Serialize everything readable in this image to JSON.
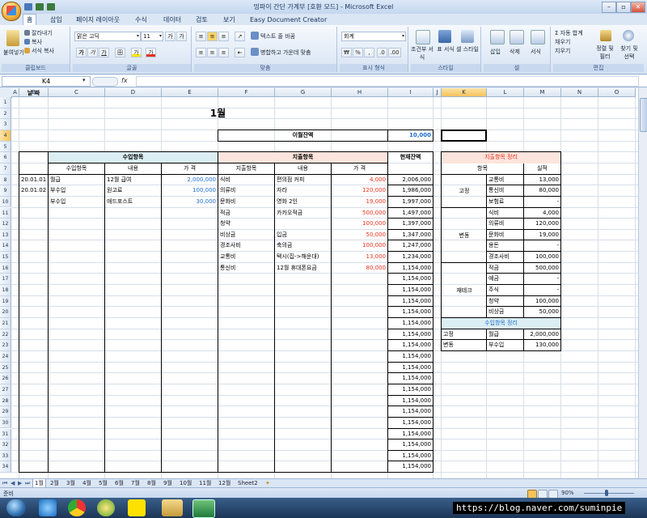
{
  "window": {
    "title": "밍파이 간단 가계부 [호환 모드] - Microsoft Excel",
    "min": "–",
    "max": "▫",
    "close": "✕"
  },
  "tabs": [
    "홈",
    "삽입",
    "페이지 레이아웃",
    "수식",
    "데이터",
    "검토",
    "보기",
    "Easy Document Creator"
  ],
  "ribbon": {
    "clipboard": {
      "paste": "붙여넣기",
      "cut": "잘라내기",
      "copy": "복사",
      "format_painter": "서식 복사",
      "label": "클립보드"
    },
    "font": {
      "name": "맑은 고딕",
      "size": "11",
      "grow": "가",
      "shrink": "가",
      "bold": "가",
      "italic": "가",
      "underline": "가",
      "border": "田",
      "fill": "가",
      "color": "가",
      "label": "글꼴"
    },
    "align": {
      "wrap": "텍스트 줄 바꿈",
      "merge": "병합하고 가운데 맞춤",
      "label": "맞춤"
    },
    "number": {
      "format": "회계",
      "currency": "₩",
      "percent": "%",
      "comma": ",",
      "inc": ".0",
      "dec": ".00",
      "label": "표시 형식"
    },
    "style": {
      "cond": "조건부 서식",
      "table": "표 서식",
      "cell": "셀 스타일",
      "label": "스타일"
    },
    "cells": {
      "insert": "삽입",
      "delete": "삭제",
      "format": "서식",
      "label": "셀"
    },
    "edit": {
      "autosum": "Σ 자동 합계",
      "fill": "채우기",
      "clear": "지우기",
      "sort": "정렬 및 필터",
      "find": "찾기 및 선택",
      "label": "편집"
    }
  },
  "formula_bar": {
    "name_box": "K4",
    "fx": "fx",
    "content": ""
  },
  "columns": [
    "A",
    "B",
    "C",
    "D",
    "E",
    "F",
    "G",
    "H",
    "I",
    "J",
    "K",
    "L",
    "M",
    "N",
    "O"
  ],
  "rows": [
    "1",
    "2",
    "3",
    "4",
    "5",
    "6",
    "7",
    "8",
    "9",
    "10",
    "11",
    "12",
    "13",
    "14",
    "15",
    "16",
    "17",
    "18",
    "19",
    "20",
    "21",
    "22",
    "23",
    "24",
    "25",
    "26",
    "27",
    "28",
    "29",
    "30",
    "31",
    "32",
    "33",
    "34"
  ],
  "sheet": {
    "title": "1월",
    "carry_label": "이월잔액",
    "carry_value": "10,000",
    "date_header": "날 짜",
    "income_header": "수입항목",
    "income_cols": [
      "수입항목",
      "내용",
      "가 격"
    ],
    "expense_header": "지출항목",
    "expense_cols": [
      "지출항목",
      "내용",
      "가 격"
    ],
    "balance_header": "현재잔액",
    "income_rows": [
      {
        "date": "20.01.01",
        "item": "월급",
        "desc": "12월 급여",
        "price": "2,000,000"
      },
      {
        "date": "20.01.02",
        "item": "부수입",
        "desc": "원고료",
        "price": "100,000"
      },
      {
        "date": "",
        "item": "부수입",
        "desc": "애드포스트",
        "price": "30,000"
      }
    ],
    "expense_rows": [
      {
        "item": "식비",
        "desc": "편의점 커피",
        "price": "4,000"
      },
      {
        "item": "의류비",
        "desc": "자라",
        "price": "120,000"
      },
      {
        "item": "문화비",
        "desc": "영화 2인",
        "price": "19,000"
      },
      {
        "item": "적금",
        "desc": "카카오적금",
        "price": "500,000"
      },
      {
        "item": "청약",
        "desc": "",
        "price": "100,000"
      },
      {
        "item": "비상금",
        "desc": "입금",
        "price": "50,000"
      },
      {
        "item": "경조사비",
        "desc": "축의금",
        "price": "100,000"
      },
      {
        "item": "교통비",
        "desc": "택시(집->해운대)",
        "price": "13,000"
      },
      {
        "item": "통신비",
        "desc": "12월 휴대폰요금",
        "price": "80,000"
      }
    ],
    "balances": [
      "2,006,000",
      "1,986,000",
      "1,997,000",
      "1,497,000",
      "1,397,000",
      "1,347,000",
      "1,247,000",
      "1,234,000",
      "1,154,000",
      "1,154,000",
      "1,154,000",
      "1,154,000",
      "1,154,000",
      "1,154,000",
      "1,154,000",
      "1,154,000",
      "1,154,000",
      "1,154,000",
      "1,154,000",
      "1,154,000",
      "1,154,000",
      "1,154,000",
      "1,154,000",
      "1,154,000",
      "1,154,000",
      "1,154,000",
      "1,154,000"
    ],
    "summary_title": "지출항목 정리",
    "summary_cols": [
      "항목",
      "실적"
    ],
    "summary_groups": [
      {
        "group": "고정",
        "rows": [
          {
            "name": "교통비",
            "value": "13,000"
          },
          {
            "name": "통신비",
            "value": "80,000"
          },
          {
            "name": "보험료",
            "value": "-"
          }
        ]
      },
      {
        "group": "변동",
        "rows": [
          {
            "name": "식비",
            "value": "4,000"
          },
          {
            "name": "의류비",
            "value": "120,000"
          },
          {
            "name": "문화비",
            "value": "19,000"
          },
          {
            "name": "용돈",
            "value": "-"
          },
          {
            "name": "경조사비",
            "value": "100,000"
          }
        ]
      },
      {
        "group": "재테크",
        "rows": [
          {
            "name": "적금",
            "value": "500,000"
          },
          {
            "name": "예금",
            "value": "-"
          },
          {
            "name": "주식",
            "value": "-"
          },
          {
            "name": "청약",
            "value": "100,000"
          },
          {
            "name": "비상금",
            "value": "50,000"
          }
        ]
      }
    ],
    "income_summary_title": "수입항목 정리",
    "income_summary": [
      {
        "group": "고정",
        "name": "월급",
        "value": "2,000,000"
      },
      {
        "group": "변동",
        "name": "부수입",
        "value": "130,000"
      }
    ]
  },
  "sheet_tabs": [
    "1월",
    "2월",
    "3월",
    "4월",
    "5월",
    "6월",
    "7월",
    "8월",
    "9월",
    "10월",
    "11월",
    "12월",
    "Sheet2"
  ],
  "status": {
    "ready": "준비",
    "zoom": "90%"
  },
  "watermark": "https://blog.naver.com/suminpie",
  "colors": {
    "income_header": "#dbeef3",
    "expense_header": "#fde4dc",
    "red_text": "#e8321e",
    "blue_text": "#1f6fd1"
  }
}
